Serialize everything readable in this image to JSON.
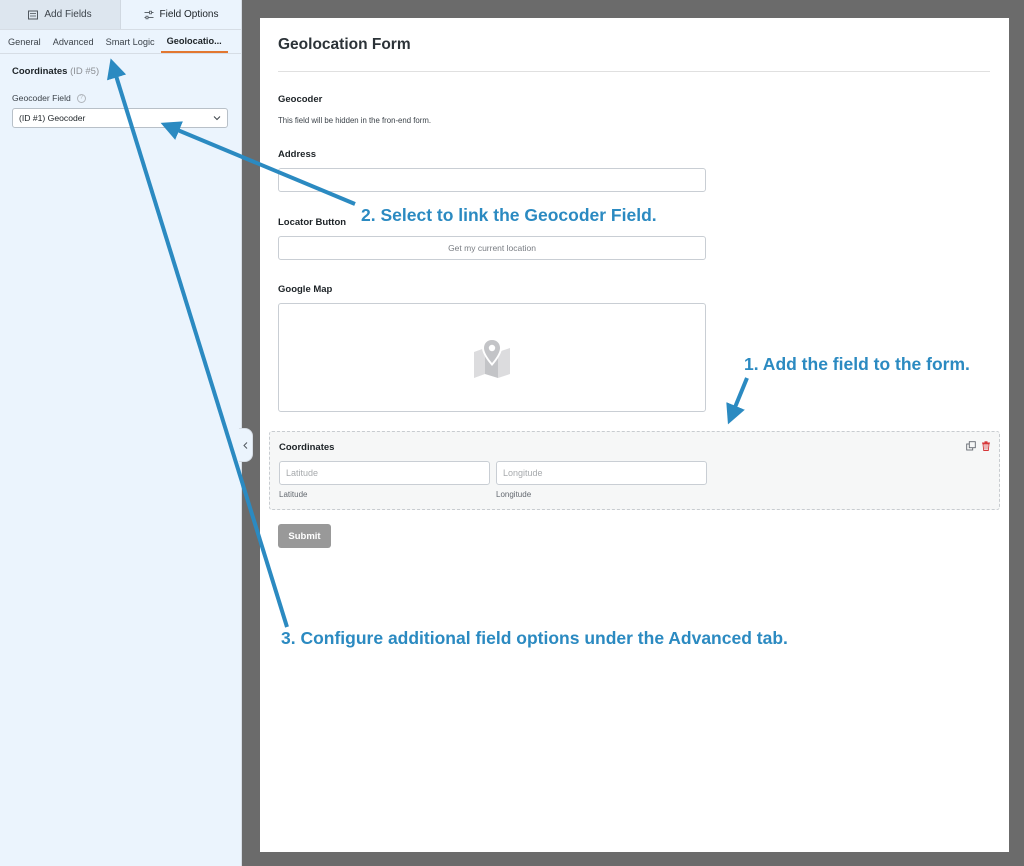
{
  "sidebar": {
    "panel_tabs": [
      {
        "label": "Add Fields",
        "icon": "list-icon"
      },
      {
        "label": "Field Options",
        "icon": "sliders-icon"
      }
    ],
    "sub_tabs": [
      "General",
      "Advanced",
      "Smart Logic",
      "Geolocatio..."
    ],
    "active_sub_tab": "Geolocatio...",
    "field_name": "Coordinates",
    "field_id": "(ID #5)",
    "option_label": "Geocoder Field",
    "help_symbol": "?",
    "select_value": "(ID #1) Geocoder"
  },
  "form": {
    "title": "Geolocation Form",
    "fields": {
      "geocoder": {
        "label": "Geocoder",
        "description": "This field will be hidden in the fron-end form."
      },
      "address": {
        "label": "Address"
      },
      "locator": {
        "label": "Locator Button",
        "button_text": "Get my current location"
      },
      "map": {
        "label": "Google Map"
      },
      "coordinates": {
        "label": "Coordinates",
        "lat_placeholder": "Latitude",
        "lng_placeholder": "Longitude",
        "lat_sublabel": "Latitude",
        "lng_sublabel": "Longitude"
      }
    },
    "submit_label": "Submit"
  },
  "annotations": {
    "step1": "1. Add the field to the form.",
    "step2": "2. Select to link the Geocoder Field.",
    "step3": "3. Configure additional field options under the Advanced tab."
  },
  "colors": {
    "annotation_blue": "#2b8ac1",
    "active_tab_underline": "#e27730",
    "sidebar_bg": "#ebf4fd",
    "submit_bg": "#999999",
    "delete_red": "#d63638"
  }
}
